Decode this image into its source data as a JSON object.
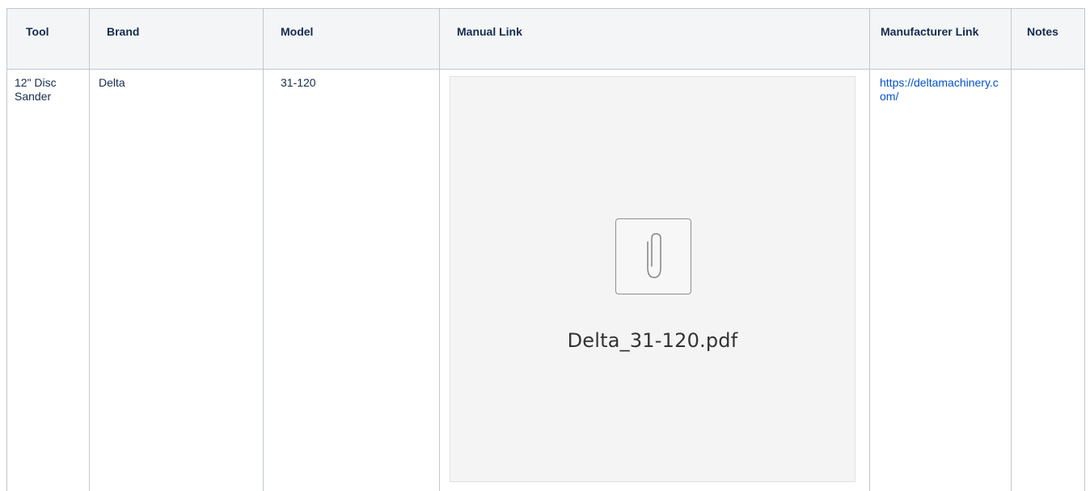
{
  "table": {
    "headers": {
      "tool": "Tool",
      "brand": "Brand",
      "model": "Model",
      "manual": "Manual Link",
      "manufacturer": "Manufacturer Link",
      "notes": "Notes"
    },
    "rows": [
      {
        "tool": "12\" Disc Sander",
        "brand": "Delta",
        "model": "31-120",
        "manual_attachment": {
          "filename": "Delta_31-120.pdf",
          "icon": "paperclip-icon"
        },
        "manufacturer_link": "https://deltamachinery.com/",
        "notes": ""
      }
    ]
  },
  "colors": {
    "header_bg": "#f4f5f7",
    "border": "#c1c7d0",
    "link": "#0052cc",
    "attachment_bg": "#f4f4f4"
  }
}
